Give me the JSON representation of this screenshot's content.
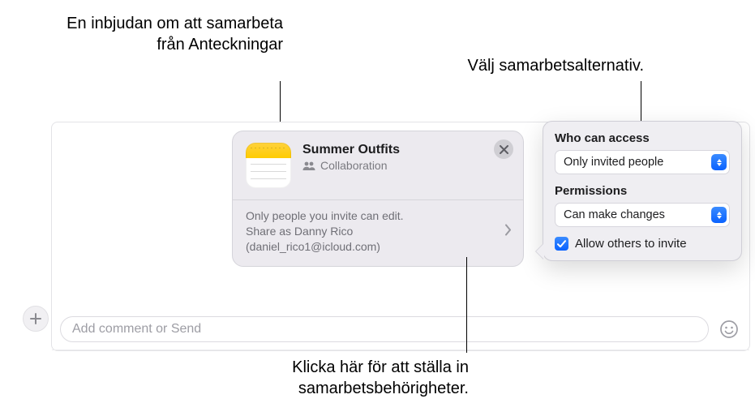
{
  "callouts": {
    "top_left": "En inbjudan om att samarbeta från Anteckningar",
    "top_right": "Välj samarbetsalternativ.",
    "bottom": "Klicka här för att ställa in samarbetsbehörigheter."
  },
  "card": {
    "title": "Summer Outfits",
    "subtitle": "Collaboration",
    "permission_summary": "Only people you invite can edit.",
    "share_as_line1": "Share as Danny Rico",
    "share_as_line2": "(daniel_rico1@icloud.com)"
  },
  "popover": {
    "access_label": "Who can access",
    "access_value": "Only invited people",
    "perm_label": "Permissions",
    "perm_value": "Can make changes",
    "allow_invite_label": "Allow others to invite",
    "allow_invite_checked": true
  },
  "compose": {
    "placeholder": "Add comment or Send"
  }
}
